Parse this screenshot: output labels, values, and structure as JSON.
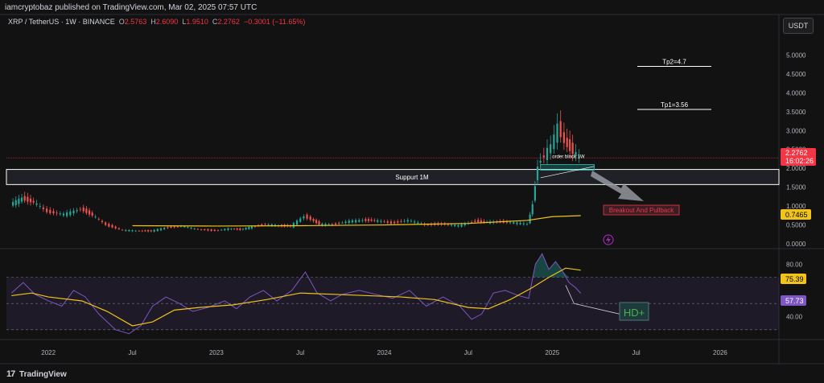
{
  "header": {
    "publisher": "iamcryptobaz published on TradingView.com, Mar 02, 2025 07:57 UTC"
  },
  "symbol": {
    "name": "XRP / TetherUS · 1W · BINANCE",
    "o_label": "O",
    "o_value": "2.5763",
    "h_label": "H",
    "h_value": "2.6090",
    "l_label": "L",
    "l_value": "1.9510",
    "c_label": "C",
    "c_value": "2.2762",
    "change": "−0.3001 (−11.65%)"
  },
  "currency_button": "USDT",
  "footer": {
    "logo": "17",
    "brand": "TradingView"
  },
  "colors": {
    "up": "#26a69a",
    "down": "#ef5350",
    "ma": "#f0c419",
    "rsi": "#7e57c2",
    "rsi_ma": "#f0c419",
    "price_badge": "#f23645",
    "background": "#121212"
  },
  "icons": {
    "bolt": "bolt-icon"
  },
  "chart_data": [
    {
      "type": "candlestick",
      "title": "XRP / TetherUS · 1W · BINANCE",
      "timeframe": "1W",
      "ylim": [
        0,
        5.5
      ],
      "y_ticks": [
        "5.0000",
        "4.5000",
        "4.0000",
        "3.5000",
        "3.0000",
        "2.5000",
        "2.0000",
        "1.5000",
        "1.0000",
        "0.5000",
        "0.0000"
      ],
      "x_ticks": [
        "2022",
        "Jul",
        "2023",
        "Jul",
        "2024",
        "Jul",
        "2025",
        "Jul",
        "2026"
      ],
      "x_range": [
        2021.75,
        2026.35
      ],
      "price_path": [
        [
          2021.78,
          1.05
        ],
        [
          2021.85,
          1.2
        ],
        [
          2021.92,
          1.1
        ],
        [
          2022.0,
          0.85
        ],
        [
          2022.1,
          0.78
        ],
        [
          2022.2,
          0.92
        ],
        [
          2022.27,
          0.76
        ],
        [
          2022.35,
          0.5
        ],
        [
          2022.45,
          0.36
        ],
        [
          2022.55,
          0.34
        ],
        [
          2022.62,
          0.34
        ],
        [
          2022.7,
          0.42
        ],
        [
          2022.8,
          0.47
        ],
        [
          2022.9,
          0.38
        ],
        [
          2023.0,
          0.35
        ],
        [
          2023.08,
          0.4
        ],
        [
          2023.15,
          0.38
        ],
        [
          2023.22,
          0.45
        ],
        [
          2023.3,
          0.52
        ],
        [
          2023.38,
          0.48
        ],
        [
          2023.45,
          0.47
        ],
        [
          2023.53,
          0.73
        ],
        [
          2023.57,
          0.65
        ],
        [
          2023.62,
          0.52
        ],
        [
          2023.7,
          0.51
        ],
        [
          2023.8,
          0.6
        ],
        [
          2023.88,
          0.62
        ],
        [
          2023.95,
          0.62
        ],
        [
          2024.05,
          0.55
        ],
        [
          2024.15,
          0.62
        ],
        [
          2024.25,
          0.5
        ],
        [
          2024.35,
          0.52
        ],
        [
          2024.45,
          0.48
        ],
        [
          2024.55,
          0.6
        ],
        [
          2024.62,
          0.57
        ],
        [
          2024.7,
          0.58
        ],
        [
          2024.8,
          0.55
        ],
        [
          2024.86,
          0.52
        ],
        [
          2024.89,
          1.05
        ],
        [
          2024.92,
          2.1
        ],
        [
          2024.96,
          2.35
        ],
        [
          2025.0,
          2.6
        ],
        [
          2025.04,
          3.1
        ],
        [
          2025.08,
          2.7
        ],
        [
          2025.13,
          2.45
        ],
        [
          2025.17,
          2.28
        ]
      ],
      "moving_average": [
        [
          2022.5,
          0.48
        ],
        [
          2023.0,
          0.47
        ],
        [
          2023.5,
          0.48
        ],
        [
          2024.0,
          0.5
        ],
        [
          2024.5,
          0.54
        ],
        [
          2024.85,
          0.62
        ],
        [
          2025.0,
          0.72
        ],
        [
          2025.17,
          0.7465
        ]
      ],
      "last_price": "2.2762",
      "countdown": "16:02:26",
      "ma_value": "0.7465",
      "annotations": {
        "tp2": {
          "label": "Tp2=4.7",
          "price": 4.7
        },
        "tp1": {
          "label": "Tp1=3.56",
          "price": 3.56
        },
        "order_block": {
          "label": "order block 1W",
          "top": 2.1,
          "bottom": 1.95
        },
        "support": {
          "label": "Suppurt 1M",
          "top": 1.97,
          "bottom": 1.57
        },
        "breakout": {
          "label": "Breakout And Pullback"
        }
      }
    },
    {
      "type": "line",
      "name": "RSI",
      "ylim": [
        25,
        90
      ],
      "y_ticks": [
        "80.00",
        "40.00"
      ],
      "bands": {
        "upper": 70,
        "middle": 50,
        "lower": 30
      },
      "rsi_value": "57.73",
      "rsi_ma_value": "75.39",
      "annotation": "HD+",
      "rsi": [
        [
          2021.78,
          58
        ],
        [
          2021.85,
          66
        ],
        [
          2021.92,
          57
        ],
        [
          2022.0,
          52
        ],
        [
          2022.08,
          48
        ],
        [
          2022.15,
          60
        ],
        [
          2022.22,
          55
        ],
        [
          2022.3,
          42
        ],
        [
          2022.4,
          30
        ],
        [
          2022.48,
          27
        ],
        [
          2022.55,
          33
        ],
        [
          2022.62,
          48
        ],
        [
          2022.7,
          55
        ],
        [
          2022.78,
          50
        ],
        [
          2022.86,
          44
        ],
        [
          2022.95,
          47
        ],
        [
          2023.05,
          52
        ],
        [
          2023.12,
          46
        ],
        [
          2023.2,
          55
        ],
        [
          2023.28,
          60
        ],
        [
          2023.36,
          52
        ],
        [
          2023.45,
          60
        ],
        [
          2023.53,
          74
        ],
        [
          2023.6,
          58
        ],
        [
          2023.68,
          52
        ],
        [
          2023.75,
          57
        ],
        [
          2023.85,
          60
        ],
        [
          2023.95,
          57
        ],
        [
          2024.05,
          54
        ],
        [
          2024.15,
          60
        ],
        [
          2024.25,
          48
        ],
        [
          2024.35,
          55
        ],
        [
          2024.45,
          48
        ],
        [
          2024.52,
          38
        ],
        [
          2024.58,
          42
        ],
        [
          2024.65,
          58
        ],
        [
          2024.72,
          60
        ],
        [
          2024.8,
          56
        ],
        [
          2024.86,
          54
        ],
        [
          2024.9,
          80
        ],
        [
          2024.94,
          88
        ],
        [
          2024.98,
          76
        ],
        [
          2025.02,
          82
        ],
        [
          2025.06,
          75
        ],
        [
          2025.1,
          66
        ],
        [
          2025.14,
          62
        ],
        [
          2025.17,
          57.73
        ]
      ],
      "rsi_ma": [
        [
          2021.78,
          56
        ],
        [
          2021.9,
          58
        ],
        [
          2022.0,
          55
        ],
        [
          2022.2,
          52
        ],
        [
          2022.35,
          44
        ],
        [
          2022.5,
          33
        ],
        [
          2022.62,
          36
        ],
        [
          2022.75,
          45
        ],
        [
          2022.9,
          47
        ],
        [
          2023.1,
          49
        ],
        [
          2023.3,
          53
        ],
        [
          2023.5,
          58
        ],
        [
          2023.7,
          57
        ],
        [
          2023.9,
          56
        ],
        [
          2024.1,
          55
        ],
        [
          2024.3,
          53
        ],
        [
          2024.5,
          47
        ],
        [
          2024.62,
          46
        ],
        [
          2024.75,
          53
        ],
        [
          2024.88,
          62
        ],
        [
          2024.98,
          70
        ],
        [
          2025.08,
          77
        ],
        [
          2025.17,
          75.39
        ]
      ]
    }
  ]
}
